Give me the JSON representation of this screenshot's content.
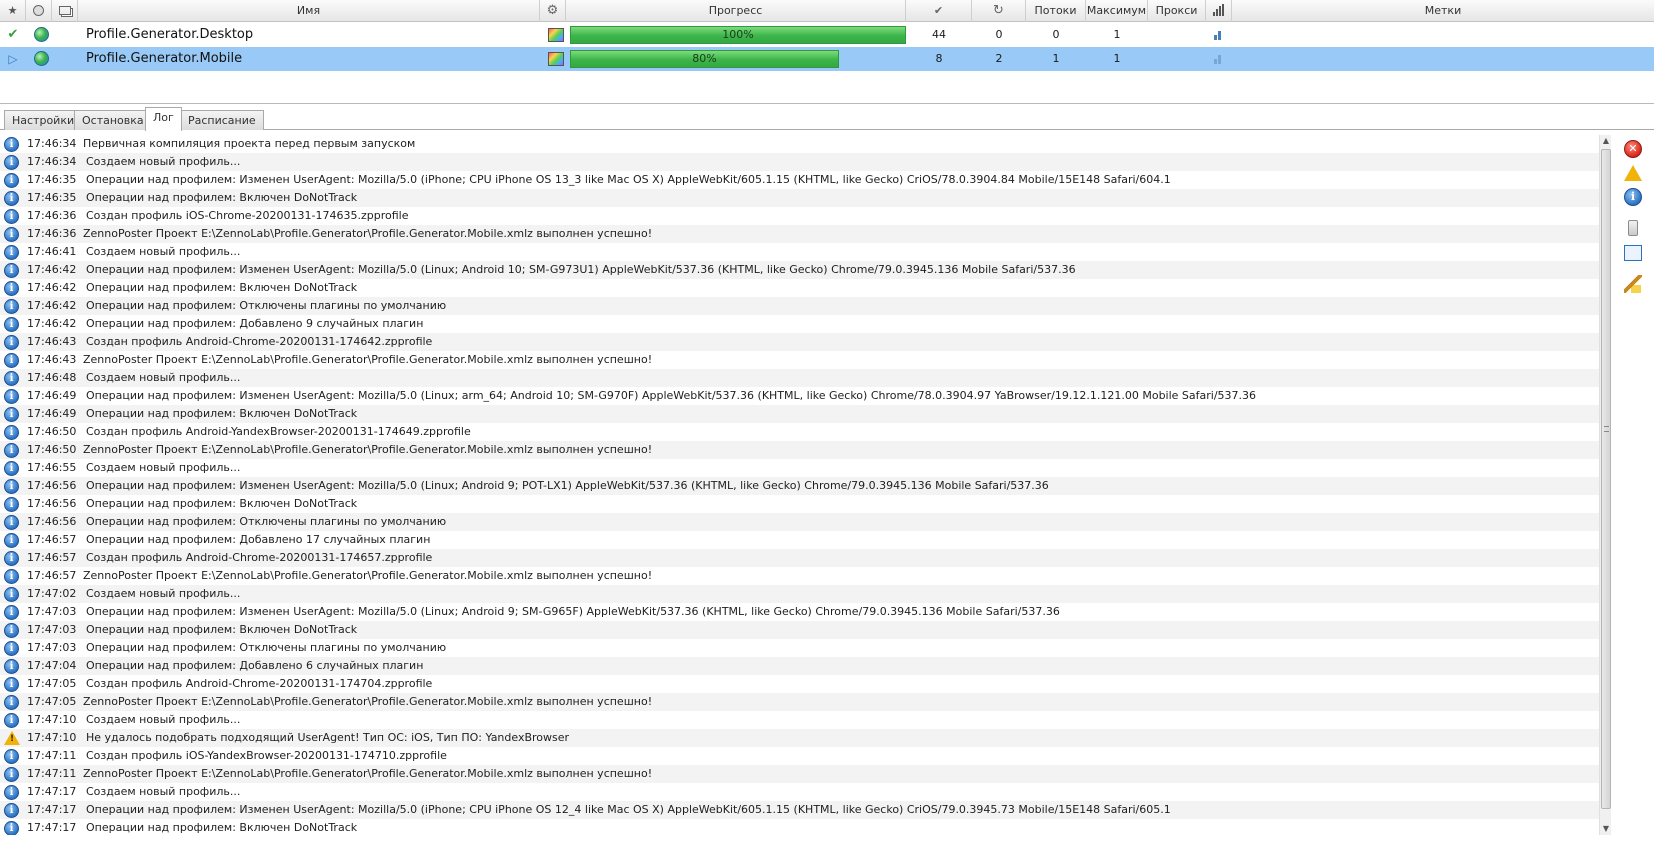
{
  "grid": {
    "columns": {
      "status": "",
      "browser": "",
      "window": "",
      "name": "Имя",
      "settings": "",
      "progress": "Прогресс",
      "success": "",
      "retries": "",
      "threads": "Потоки",
      "max": "Максимум",
      "proxy": "Прокси",
      "stats": "",
      "tags": "Метки"
    },
    "rows": [
      {
        "status_icon": "checkmark-icon",
        "name": "Profile.Generator.Desktop",
        "progress": 100,
        "progress_label": "100%",
        "success": "44",
        "retries": "0",
        "threads": "0",
        "max": "1",
        "selected": false
      },
      {
        "status_icon": "play-icon",
        "name": "Profile.Generator.Mobile",
        "progress": 80,
        "progress_label": "80%",
        "success": "8",
        "retries": "2",
        "threads": "1",
        "max": "1",
        "selected": true
      }
    ]
  },
  "tabs": [
    {
      "label": "Настройки",
      "active": false
    },
    {
      "label": "Остановка",
      "active": false
    },
    {
      "label": "Лог",
      "active": true
    },
    {
      "label": "Расписание",
      "active": false
    }
  ],
  "log": [
    {
      "type": "info",
      "time": "17:46:34",
      "msg": "Первичная компиляция проекта перед первым запуском"
    },
    {
      "type": "info",
      "time": "17:46:34",
      "msg": "Создаем новый профиль..."
    },
    {
      "type": "info",
      "time": "17:46:35",
      "msg": "Операции над профилем: Изменен UserAgent: Mozilla/5.0 (iPhone; CPU iPhone OS 13_3 like Mac OS X) AppleWebKit/605.1.15 (KHTML, like Gecko) CriOS/78.0.3904.84 Mobile/15E148 Safari/604.1"
    },
    {
      "type": "info",
      "time": "17:46:35",
      "msg": "Операции над профилем: Включен DoNotTrack"
    },
    {
      "type": "info",
      "time": "17:46:36",
      "msg": "Создан профиль iOS-Chrome-20200131-174635.zpprofile"
    },
    {
      "type": "info",
      "time": "17:46:36",
      "msg": "ZennoPoster Проект E:\\ZennoLab\\Profile.Generator\\Profile.Generator.Mobile.xmlz выполнен успешно!"
    },
    {
      "type": "info",
      "time": "17:46:41",
      "msg": "Создаем новый профиль..."
    },
    {
      "type": "info",
      "time": "17:46:42",
      "msg": "Операции над профилем: Изменен UserAgent: Mozilla/5.0 (Linux; Android 10; SM-G973U1) AppleWebKit/537.36 (KHTML, like Gecko) Chrome/79.0.3945.136 Mobile Safari/537.36"
    },
    {
      "type": "info",
      "time": "17:46:42",
      "msg": "Операции над профилем: Включен DoNotTrack"
    },
    {
      "type": "info",
      "time": "17:46:42",
      "msg": "Операции над профилем: Отключены плагины по умолчанию"
    },
    {
      "type": "info",
      "time": "17:46:42",
      "msg": "Операции над профилем: Добавлено 9 случайных плагин"
    },
    {
      "type": "info",
      "time": "17:46:43",
      "msg": "Создан профиль Android-Chrome-20200131-174642.zpprofile"
    },
    {
      "type": "info",
      "time": "17:46:43",
      "msg": "ZennoPoster Проект E:\\ZennoLab\\Profile.Generator\\Profile.Generator.Mobile.xmlz выполнен успешно!"
    },
    {
      "type": "info",
      "time": "17:46:48",
      "msg": "Создаем новый профиль..."
    },
    {
      "type": "info",
      "time": "17:46:49",
      "msg": "Операции над профилем: Изменен UserAgent: Mozilla/5.0 (Linux; arm_64; Android 10; SM-G970F) AppleWebKit/537.36 (KHTML, like Gecko) Chrome/78.0.3904.97 YaBrowser/19.12.1.121.00 Mobile Safari/537.36"
    },
    {
      "type": "info",
      "time": "17:46:49",
      "msg": "Операции над профилем: Включен DoNotTrack"
    },
    {
      "type": "info",
      "time": "17:46:50",
      "msg": "Создан профиль Android-YandexBrowser-20200131-174649.zpprofile"
    },
    {
      "type": "info",
      "time": "17:46:50",
      "msg": "ZennoPoster Проект E:\\ZennoLab\\Profile.Generator\\Profile.Generator.Mobile.xmlz выполнен успешно!"
    },
    {
      "type": "info",
      "time": "17:46:55",
      "msg": "Создаем новый профиль..."
    },
    {
      "type": "info",
      "time": "17:46:56",
      "msg": "Операции над профилем: Изменен UserAgent: Mozilla/5.0 (Linux; Android 9; POT-LX1) AppleWebKit/537.36 (KHTML, like Gecko) Chrome/79.0.3945.136 Mobile Safari/537.36"
    },
    {
      "type": "info",
      "time": "17:46:56",
      "msg": "Операции над профилем: Включен DoNotTrack"
    },
    {
      "type": "info",
      "time": "17:46:56",
      "msg": "Операции над профилем: Отключены плагины по умолчанию"
    },
    {
      "type": "info",
      "time": "17:46:57",
      "msg": "Операции над профилем: Добавлено 17 случайных плагин"
    },
    {
      "type": "info",
      "time": "17:46:57",
      "msg": "Создан профиль Android-Chrome-20200131-174657.zpprofile"
    },
    {
      "type": "info",
      "time": "17:46:57",
      "msg": "ZennoPoster Проект E:\\ZennoLab\\Profile.Generator\\Profile.Generator.Mobile.xmlz выполнен успешно!"
    },
    {
      "type": "info",
      "time": "17:47:02",
      "msg": "Создаем новый профиль..."
    },
    {
      "type": "info",
      "time": "17:47:03",
      "msg": "Операции над профилем: Изменен UserAgent: Mozilla/5.0 (Linux; Android 9; SM-G965F) AppleWebKit/537.36 (KHTML, like Gecko) Chrome/79.0.3945.136 Mobile Safari/537.36"
    },
    {
      "type": "info",
      "time": "17:47:03",
      "msg": "Операции над профилем: Включен DoNotTrack"
    },
    {
      "type": "info",
      "time": "17:47:03",
      "msg": "Операции над профилем: Отключены плагины по умолчанию"
    },
    {
      "type": "info",
      "time": "17:47:04",
      "msg": "Операции над профилем: Добавлено 6 случайных плагин"
    },
    {
      "type": "info",
      "time": "17:47:05",
      "msg": "Создан профиль Android-Chrome-20200131-174704.zpprofile"
    },
    {
      "type": "info",
      "time": "17:47:05",
      "msg": "ZennoPoster Проект E:\\ZennoLab\\Profile.Generator\\Profile.Generator.Mobile.xmlz выполнен успешно!"
    },
    {
      "type": "info",
      "time": "17:47:10",
      "msg": "Создаем новый профиль..."
    },
    {
      "type": "warning",
      "time": "17:47:10",
      "msg": "Не удалось подобрать подходящий UserAgent! Тип ОС: iOS, Тип ПО: YandexBrowser"
    },
    {
      "type": "info",
      "time": "17:47:11",
      "msg": "Создан профиль iOS-YandexBrowser-20200131-174710.zpprofile"
    },
    {
      "type": "info",
      "time": "17:47:11",
      "msg": "ZennoPoster Проект E:\\ZennoLab\\Profile.Generator\\Profile.Generator.Mobile.xmlz выполнен успешно!"
    },
    {
      "type": "info",
      "time": "17:47:17",
      "msg": "Создаем новый профиль..."
    },
    {
      "type": "info",
      "time": "17:47:17",
      "msg": "Операции над профилем: Изменен UserAgent: Mozilla/5.0 (iPhone; CPU iPhone OS 12_4 like Mac OS X) AppleWebKit/605.1.15 (KHTML, like Gecko) CriOS/79.0.3945.73 Mobile/15E148 Safari/605.1"
    },
    {
      "type": "info",
      "time": "17:47:17",
      "msg": "Операции над профилем: Включен DoNotTrack"
    }
  ],
  "colors": {
    "selection": "#99c9f6",
    "progress": "#3cb54a",
    "info": "#2c72c4",
    "warning": "#f1b30a",
    "error": "#d8261b"
  }
}
